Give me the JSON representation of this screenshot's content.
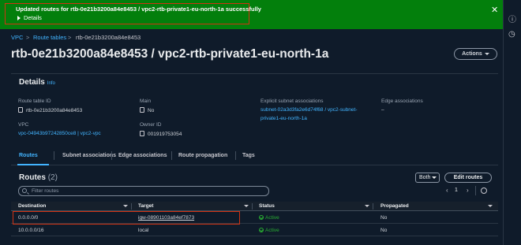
{
  "banner": {
    "message": "Updated routes for rtb-0e21b3200a84e8453 / vpc2-rtb-private1-eu-north-1a successfully",
    "details_label": "Details",
    "close_icon": "close-icon",
    "color": "#037f0c"
  },
  "breadcrumb": {
    "items": [
      "VPC",
      "Route tables",
      "rtb-0e21b3200a84e8453"
    ],
    "separator": ">"
  },
  "page": {
    "title": "rtb-0e21b3200a84e8453 / vpc2-rtb-private1-eu-north-1a",
    "actions_label": "Actions"
  },
  "details": {
    "heading": "Details",
    "info_label": "Info",
    "route_table_id_label": "Route table ID",
    "route_table_id": "rtb-0e21b3200a84e8453",
    "main_label": "Main",
    "main_value": "No",
    "explicit_subnet_label": "Explicit subnet associations",
    "explicit_subnet_line1": "subnet-02a3d3fa2e6d74f68 / vpc2-subnet-",
    "explicit_subnet_line2": "private1-eu-north-1a",
    "edge_assoc_label": "Edge associations",
    "edge_assoc_value": "–",
    "vpc_label": "VPC",
    "vpc_value": "vpc-04943b97242850ce8 | vpc2-vpc",
    "owner_label": "Owner ID",
    "owner_value": "001919753054"
  },
  "tabs": [
    "Routes",
    "Subnet associations",
    "Edge associations",
    "Route propagation",
    "Tags"
  ],
  "routes": {
    "heading": "Routes",
    "count": "(2)",
    "filter_label": "Both",
    "edit_label": "Edit routes",
    "search_placeholder": "Filter routes",
    "page_number": "1",
    "columns": [
      "Destination",
      "Target",
      "Status",
      "Propagated"
    ],
    "rows": [
      {
        "destination": "0.0.0.0/0",
        "target": "igw-08901103a84ef7873",
        "status": "Active",
        "propagated": "No"
      },
      {
        "destination": "10.0.0.0/16",
        "target": "local",
        "status": "Active",
        "propagated": "No"
      }
    ]
  },
  "colors": {
    "accent_link": "#42b4ff",
    "success": "#29ad32",
    "highlight_border": "#d13212",
    "background": "#0f1b2a"
  }
}
